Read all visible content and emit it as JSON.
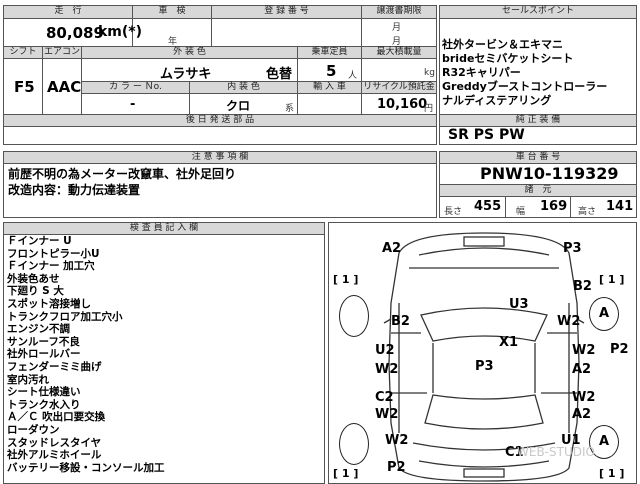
{
  "header": {
    "mileage_label": "走　行",
    "inspection_label": "車　検",
    "registration_label": "登 録 番 号",
    "transfer_label": "譲渡書期限",
    "sales_points_label": "セールスポイント",
    "mileage_value": "80,089",
    "mileage_unit": "km(*)",
    "inspection_year": "年",
    "inspection_month": "月",
    "transfer_month": "月",
    "transfer_day": "日"
  },
  "specs": {
    "shift_label": "シフト",
    "aircon_label": "エアコン",
    "ext_color_label": "外 装 色",
    "capacity_label": "乗車定員",
    "loadcap_label": "最大積載量",
    "shift_value": "F5",
    "aircon_value": "AAC",
    "ext_color_value": "ムラサキ",
    "color_change": "色替",
    "capacity_value": "5",
    "capacity_unit": "人",
    "loadcap_unit": "kg",
    "color_no_label": "カ ラ ー Ｎo.",
    "int_color_label": "内 装 色",
    "import_label": "輸 入 車",
    "recycle_label": "リサイクル預託金",
    "color_no_value": "-",
    "int_color_value": "クロ",
    "int_color_unit": "系",
    "recycle_value": "10,160",
    "recycle_unit": "円"
  },
  "sales_points": {
    "lines": [
      "社外タービン＆エキマニ",
      "brideセミバケットシート",
      "R32キャリパー",
      "Greddyブーストコントローラー",
      "ナルディステアリング"
    ]
  },
  "retrofit": {
    "label": "後 日 発 送 部 品"
  },
  "equipment": {
    "label": "純 正 装 備",
    "value": "SR PS PW"
  },
  "notes": {
    "label": "注 意 事 項 欄",
    "lines": [
      "前歴不明の為メーター改竄車、社外足回り",
      "改造内容：動力伝達装置"
    ]
  },
  "chassis": {
    "label": "車 台 番 号",
    "value": "PNW10-119329"
  },
  "dimensions": {
    "label": "諸　元",
    "length_label": "長さ",
    "length_value": "455",
    "width_label": "幅",
    "width_value": "169",
    "height_label": "高さ",
    "height_value": "141"
  },
  "inspector": {
    "label": "検 査 員 記 入 欄",
    "lines": [
      "Ｆインナー U",
      "フロントピラー小U",
      "Ｆインナー 加工穴",
      "外装色あせ",
      "下廻り S 大",
      "スポット溶接増し",
      "トランクフロア加工穴小",
      "エンジン不調",
      "サンルーフ不良",
      "社外ロールバー",
      "フェンダーミミ曲げ",
      "室内汚れ",
      "シート仕様違い",
      "トランク水入り",
      "Ａ／Ｃ 吹出口要交換",
      "ローダウン",
      "スタッドレスタイヤ",
      "社外アルミホイール",
      "バッテリー移設・コンソール加工"
    ]
  },
  "diagram": {
    "marks": [
      "A2",
      "P3",
      "B2",
      "U3",
      "A",
      "B2",
      "W2",
      "X1",
      "U2",
      "W2",
      "W2",
      "P2",
      "P3",
      "A2",
      "W2",
      "C2",
      "W2",
      "A2",
      "A",
      "W2",
      "U1",
      "C1",
      "P2"
    ],
    "brackets": [
      "[ 1 ]",
      "[ 1 ]",
      "[ 1 ]",
      "[ 1 ]"
    ],
    "watermark": "WEB-STUDIO"
  }
}
